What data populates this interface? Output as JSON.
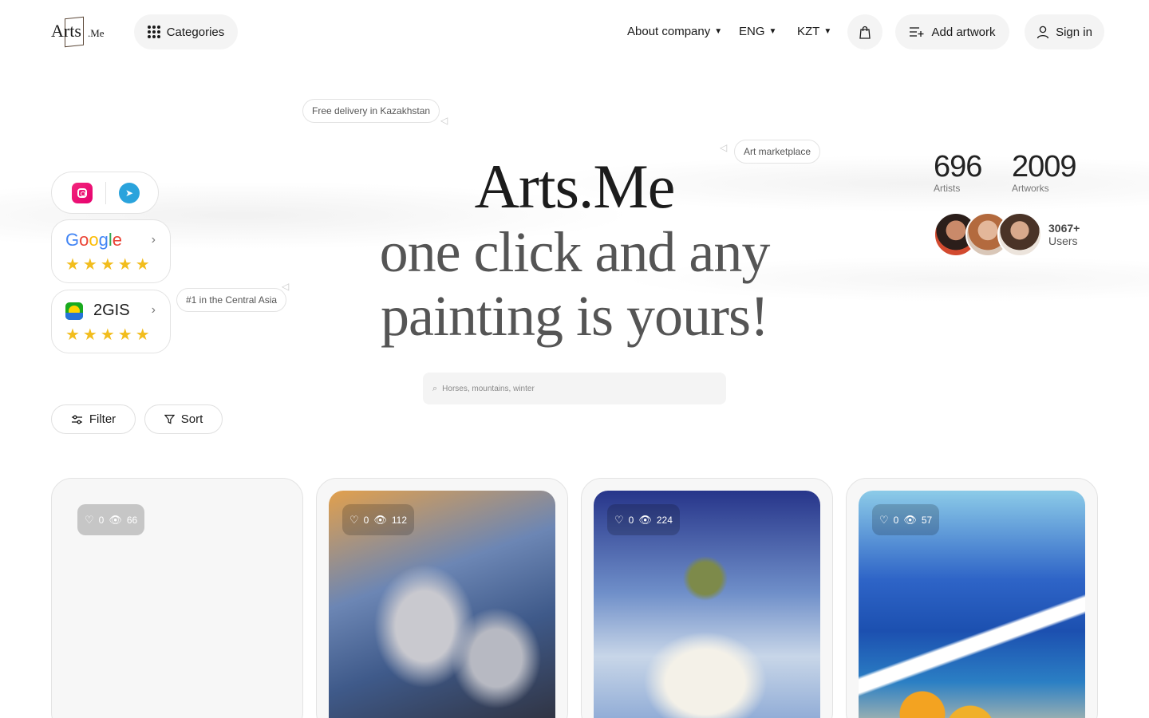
{
  "header": {
    "logo_main": "Arts",
    "logo_suffix": ".Me",
    "categories_label": "Categories",
    "about_label": "About company",
    "language": "ENG",
    "currency": "KZT",
    "add_artwork_label": "Add artwork",
    "sign_in_label": "Sign in"
  },
  "tags": {
    "delivery": "Free delivery in Kazakhstan",
    "marketplace": "Art marketplace",
    "central_asia": "#1 in the Central Asia"
  },
  "ratings": [
    {
      "name": "Google",
      "stars": "★★★★★",
      "icon": "google-logo"
    },
    {
      "name": "2GIS",
      "stars": "★★★★★",
      "icon": "2gis-logo"
    }
  ],
  "hero": {
    "title": "Arts.Me",
    "line1": "one click and any",
    "line2": "painting is yours!"
  },
  "stats": {
    "artists_num": "696",
    "artists_label": "Artists",
    "artworks_num": "2009",
    "artworks_label": "Artworks",
    "users_num": "3067+",
    "users_label": "Users"
  },
  "search": {
    "placeholder": "Horses, mountains, winter"
  },
  "controls": {
    "filter_label": "Filter",
    "sort_label": "Sort"
  },
  "cards": [
    {
      "likes": "0",
      "views": "66"
    },
    {
      "likes": "0",
      "views": "112"
    },
    {
      "likes": "0",
      "views": "224"
    },
    {
      "likes": "0",
      "views": "57"
    }
  ],
  "colors": {
    "instagram": "#e6006e",
    "telegram": "#2aa3dc",
    "star": "#f2bd1d",
    "pill_bg": "#f4f4f4"
  }
}
